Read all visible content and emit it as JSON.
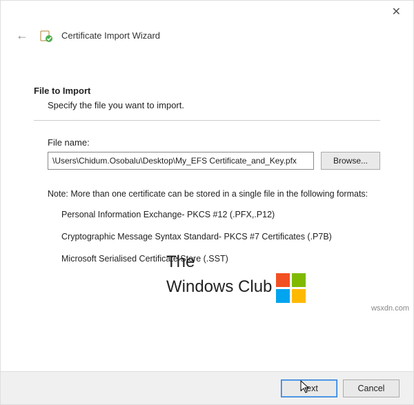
{
  "window": {
    "title": "Certificate Import Wizard"
  },
  "page": {
    "heading": "File to Import",
    "subheading": "Specify the file you want to import."
  },
  "file": {
    "label": "File name:",
    "value": "\\Users\\Chidum.Osobalu\\Desktop\\My_EFS Certificate_and_Key.pfx",
    "browse_label": "Browse..."
  },
  "note": {
    "intro": "Note:  More than one certificate can be stored in a single file in the following formats:",
    "items": [
      "Personal Information Exchange- PKCS #12 (.PFX,.P12)",
      "Cryptographic Message Syntax Standard- PKCS #7 Certificates (.P7B)",
      "Microsoft Serialised Certificate Store (.SST)"
    ]
  },
  "watermark": {
    "line1": "The",
    "line2": "Windows Club",
    "site": "wsxdn.com"
  },
  "footer": {
    "next": "Next",
    "cancel": "Cancel"
  }
}
